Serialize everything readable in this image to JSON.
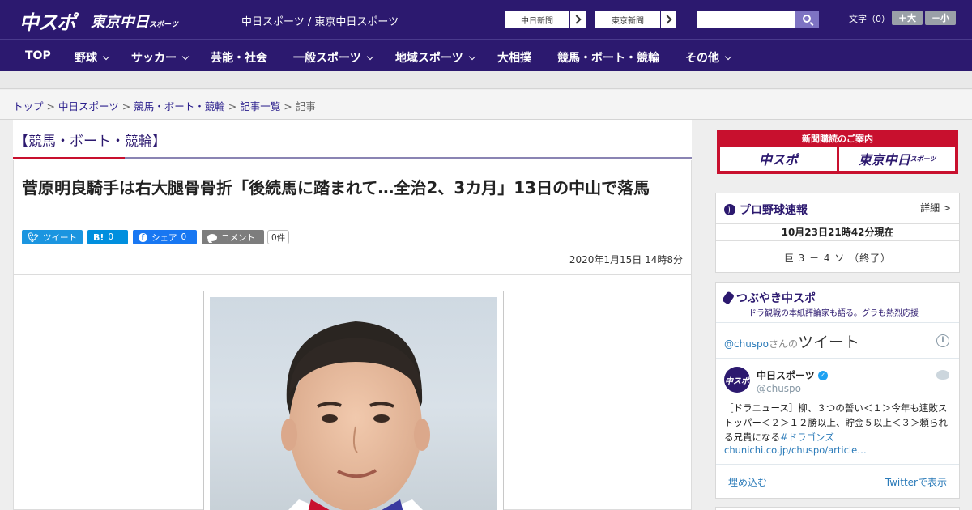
{
  "header": {
    "logo_chuspo": "中スポ",
    "logo_tokyo": "東京中日",
    "logo_tokyo_small": "スポーツ",
    "site_name": "中日スポーツ / 東京中日スポーツ",
    "paper_btn_1": "中日新聞",
    "paper_btn_2": "東京新聞",
    "search_placeholder": "",
    "font_label": "文字（0）",
    "font_plus": "＋大",
    "font_minus": "－小"
  },
  "nav": {
    "items": [
      {
        "label": "TOP"
      },
      {
        "label": "野球"
      },
      {
        "label": "サッカー"
      },
      {
        "label": "芸能・社会"
      },
      {
        "label": "一般スポーツ"
      },
      {
        "label": "地域スポーツ"
      },
      {
        "label": "大相撲"
      },
      {
        "label": "競馬・ボート・競輪"
      },
      {
        "label": "その他"
      }
    ]
  },
  "breadcrumb": {
    "items": [
      "トップ",
      "中日スポーツ",
      "競馬・ボート・競輪",
      "記事一覧"
    ],
    "current": "記事",
    "sep": ">"
  },
  "article": {
    "category": "【競馬・ボート・競輪】",
    "headline": "菅原明良騎手は右大腿骨骨折「後続馬に踏まれて…全治2、3カ月」13日の中山で落馬",
    "share": {
      "tweet": "ツイート",
      "hatena_icon": "B!",
      "hatena_count": "0",
      "facebook": "シェア",
      "facebook_count": "0",
      "comment": "コメント",
      "comment_count": "0件"
    },
    "date": "2020年1月15日 14時8分"
  },
  "sidebar": {
    "promo": {
      "title": "新聞購読のご案内",
      "logo_1": "中スポ",
      "logo_2": "東京中日",
      "logo_2_small": "スポーツ"
    },
    "baseball": {
      "title": "プロ野球速報",
      "more": "詳細 >",
      "time": "10月23日21時42分現在",
      "score": "巨 3 － 4 ソ （終了）"
    },
    "tweet": {
      "title": "つぶやき中スポ",
      "subtitle": "ドラ観戦の本紙評論家も語る。グラも熱烈応援",
      "user": "@chuspo",
      "san": "さんの",
      "tweet_word": "ツイート",
      "account_name": "中日スポーツ",
      "handle": "@chuspo",
      "text": "［ドラニュース］柳、３つの誓い＜１＞今年も連敗ストッパー＜２＞１２勝以上、貯金５以上＜３＞頼られる兄貴になる",
      "hashtag": "#ドラゴンズ",
      "link": "chunichi.co.jp/chuspo/article…",
      "embed": "埋め込む",
      "view": "Twitterで表示"
    }
  },
  "colors": {
    "brand": "#2c196f",
    "accent_red": "#c8102e",
    "link": "#2a1e8c"
  }
}
